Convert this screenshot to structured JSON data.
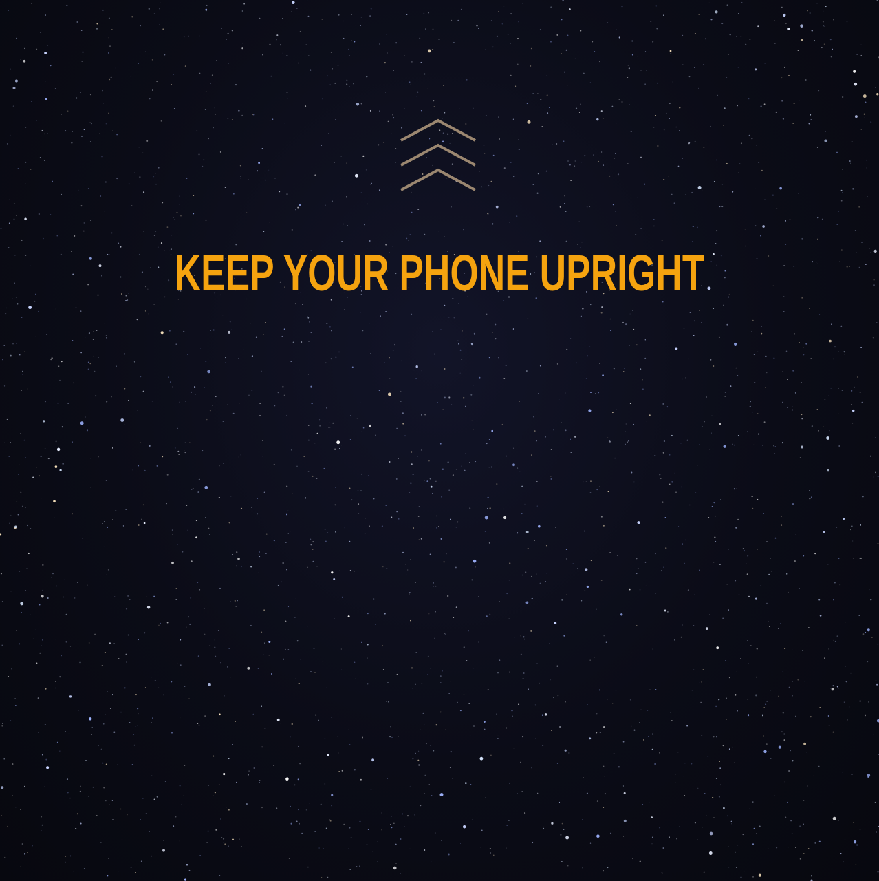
{
  "instruction": {
    "headline": "KEEP YOUR PHONE UPRIGHT",
    "icon": "triple-chevron-up-icon"
  },
  "colors": {
    "background": "#0b0c17",
    "headline": "#f5a30f",
    "chevron": "#9b8770",
    "stars": "#c8d4ff"
  }
}
